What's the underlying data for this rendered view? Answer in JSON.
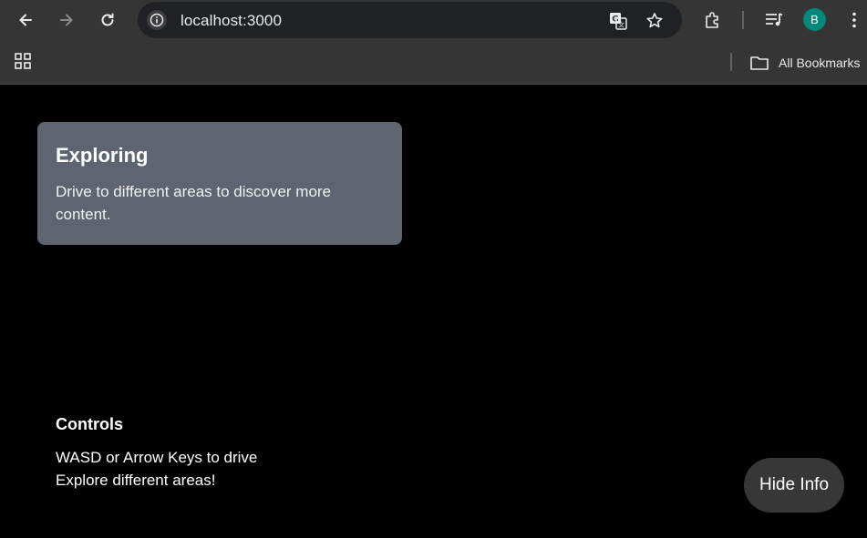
{
  "browser": {
    "url": "localhost:3000",
    "avatar_letter": "B",
    "all_bookmarks_label": "All Bookmarks",
    "icons": [
      "back-icon",
      "forward-icon",
      "reload-icon",
      "info-icon",
      "translate-icon",
      "star-icon",
      "extensions-icon",
      "media-icon",
      "more-icon",
      "apps-icon",
      "folder-icon"
    ],
    "avatar_color": "#00897b"
  },
  "page": {
    "card": {
      "title": "Exploring",
      "text": "Drive to different areas to discover more content."
    },
    "controls": {
      "title": "Controls",
      "line1": "WASD or Arrow Keys to drive",
      "line2": "Explore different areas!"
    },
    "hide_button_label": "Hide Info",
    "colors": {
      "card_bg": "#5f6570",
      "button_bg": "#373737"
    }
  }
}
